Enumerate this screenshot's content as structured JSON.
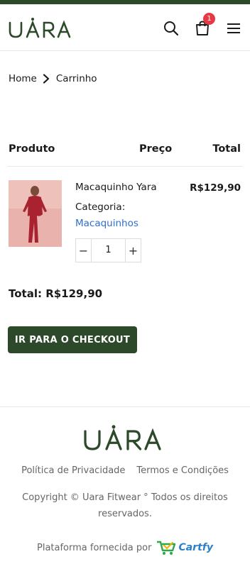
{
  "brand": {
    "name": "Uara",
    "primary_color": "#2c4a2a"
  },
  "header": {
    "icons": [
      "search-icon",
      "cart-icon",
      "menu-icon"
    ],
    "cart_count": "1",
    "badge_color": "#e53945"
  },
  "breadcrumb": {
    "home": "Home",
    "current": "Carrinho"
  },
  "table": {
    "col_product": "Produto",
    "col_price": "Preço",
    "col_total": "Total"
  },
  "item": {
    "name": "Macaquinho Yara",
    "category_label": "Categoria:",
    "category_link": "Macaquinhos",
    "quantity": "1",
    "total": "R$129,90",
    "minus": "−",
    "plus": "+"
  },
  "cart_total": "Total: R$129,90",
  "checkout_label": "IR PARA O CHECKOUT",
  "footer": {
    "links": [
      "Política de Privacidade",
      "Termos e Condições"
    ],
    "copyright": "Copyright © Uara Fitwear ° Todos os direitos reservados.",
    "platform_text": "Plataforma fornecida por",
    "platform_brand": "Cartfy"
  }
}
